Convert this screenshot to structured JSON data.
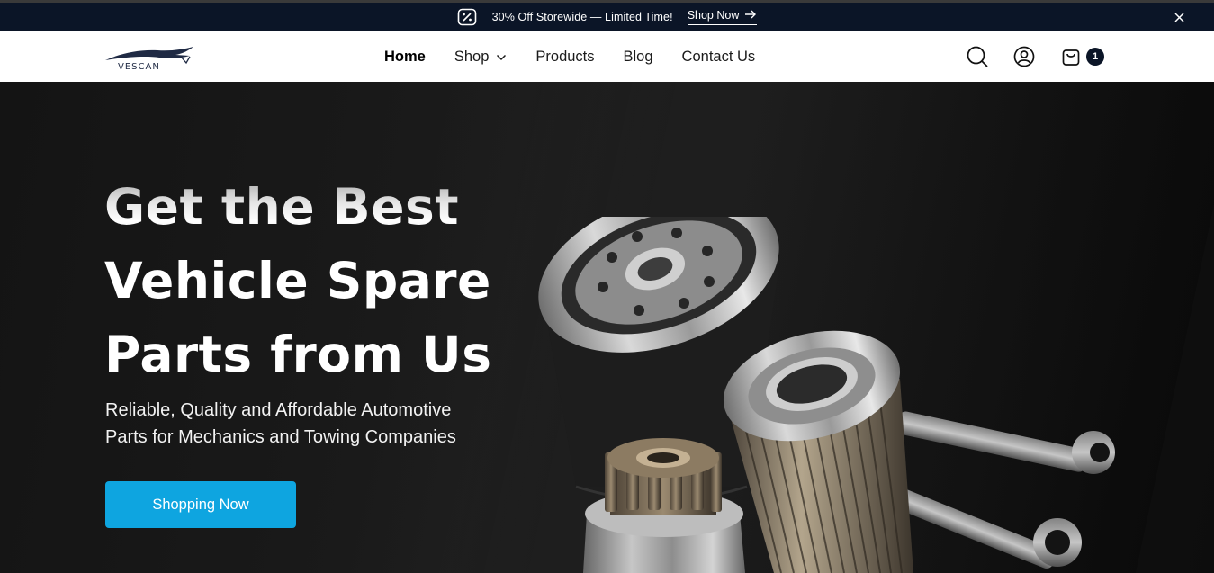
{
  "announcement": {
    "icon": "discount-tag-icon",
    "text": "30% Off Storewide — Limited Time!",
    "link_label": "Shop Now",
    "close_icon": "close-icon"
  },
  "header": {
    "logo_text": "VESCAN",
    "nav": [
      {
        "label": "Home",
        "active": true
      },
      {
        "label": "Shop",
        "has_dropdown": true
      },
      {
        "label": "Products"
      },
      {
        "label": "Blog"
      },
      {
        "label": "Contact Us"
      }
    ],
    "icons": [
      "search-icon",
      "account-icon",
      "cart-icon"
    ],
    "cart_count": "1"
  },
  "hero": {
    "title_line1": "Get the Best",
    "title_line2": "Vehicle Spare",
    "title_line3": "Parts from Us",
    "subtitle_line1": "Reliable, Quality and Affordable Automotive",
    "subtitle_line2": "Parts for Mechanics and Towing Companies",
    "cta_label": "Shopping Now",
    "image": "auto-parts-filters-gear-wrenches"
  },
  "colors": {
    "announce_bg": "#0b1527",
    "header_bg": "#ffffff",
    "hero_bg": "#141414",
    "cta_bg": "#0ea5e0",
    "cart_badge_bg": "#0b1527"
  }
}
